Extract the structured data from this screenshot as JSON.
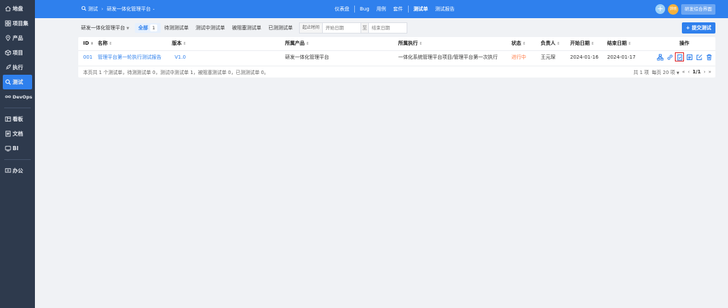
{
  "sidebar": {
    "items": [
      {
        "label": "地盘",
        "icon": "home-icon"
      },
      {
        "label": "项目集",
        "icon": "grid-icon"
      },
      {
        "label": "产品",
        "icon": "location-icon"
      },
      {
        "label": "项目",
        "icon": "cube-icon"
      },
      {
        "label": "执行",
        "icon": "rocket-icon"
      },
      {
        "label": "测试",
        "icon": "search-icon"
      },
      {
        "label": "DevOps",
        "icon": "infinity-icon"
      },
      {
        "label": "看板",
        "icon": "kanban-icon"
      },
      {
        "label": "文档",
        "icon": "doc-icon"
      },
      {
        "label": "BI",
        "icon": "bi-icon"
      },
      {
        "label": "办公",
        "icon": "office-icon"
      }
    ]
  },
  "topbar": {
    "section": "测试",
    "product": "研发一体化管理平台",
    "nav": [
      "仪表盘",
      "Bug",
      "用例",
      "套件",
      "测试单",
      "测试报告"
    ],
    "avatar_text": "饼晓",
    "user_button": "研发综合界面"
  },
  "filter": {
    "product": "研发一体化管理平台",
    "tabs": [
      {
        "label": "全部",
        "count": "1"
      },
      {
        "label": "待测测试单"
      },
      {
        "label": "测试中测试单"
      },
      {
        "label": "被阻塞测试单"
      },
      {
        "label": "已测测试单"
      }
    ],
    "date_label": "起止时间",
    "start_placeholder": "开始日期",
    "tilde": "至",
    "end_placeholder": "结束日期",
    "submit": "+ 提交测试"
  },
  "table": {
    "headers": [
      "ID",
      "名称",
      "版本",
      "所属产品",
      "所属执行",
      "状态",
      "负责人",
      "开始日期",
      "结束日期",
      "操作"
    ],
    "rows": [
      {
        "id": "001",
        "name": "管理平台第一轮执行测试报告",
        "version": "V1.0",
        "product": "研发一体化管理平台",
        "execution": "一体化系统管理平台项目/管理平台第一次执行",
        "status": "进行中",
        "owner": "王元琛",
        "start": "2024-01-16",
        "end": "2024-01-17"
      }
    ],
    "summary": "本页共 1 个测试单，待测测试单 0，测试中测试单 1，被阻塞测试单 0，已测测试单 0。",
    "pager": {
      "total": "共 1 项",
      "per_page": "每页 20 项",
      "page": "1/1"
    }
  },
  "colors": {
    "accent": "#2f80ed",
    "sidebar": "#2e3a4d",
    "status_active": "#ff7a45",
    "highlight": "#e02020"
  }
}
